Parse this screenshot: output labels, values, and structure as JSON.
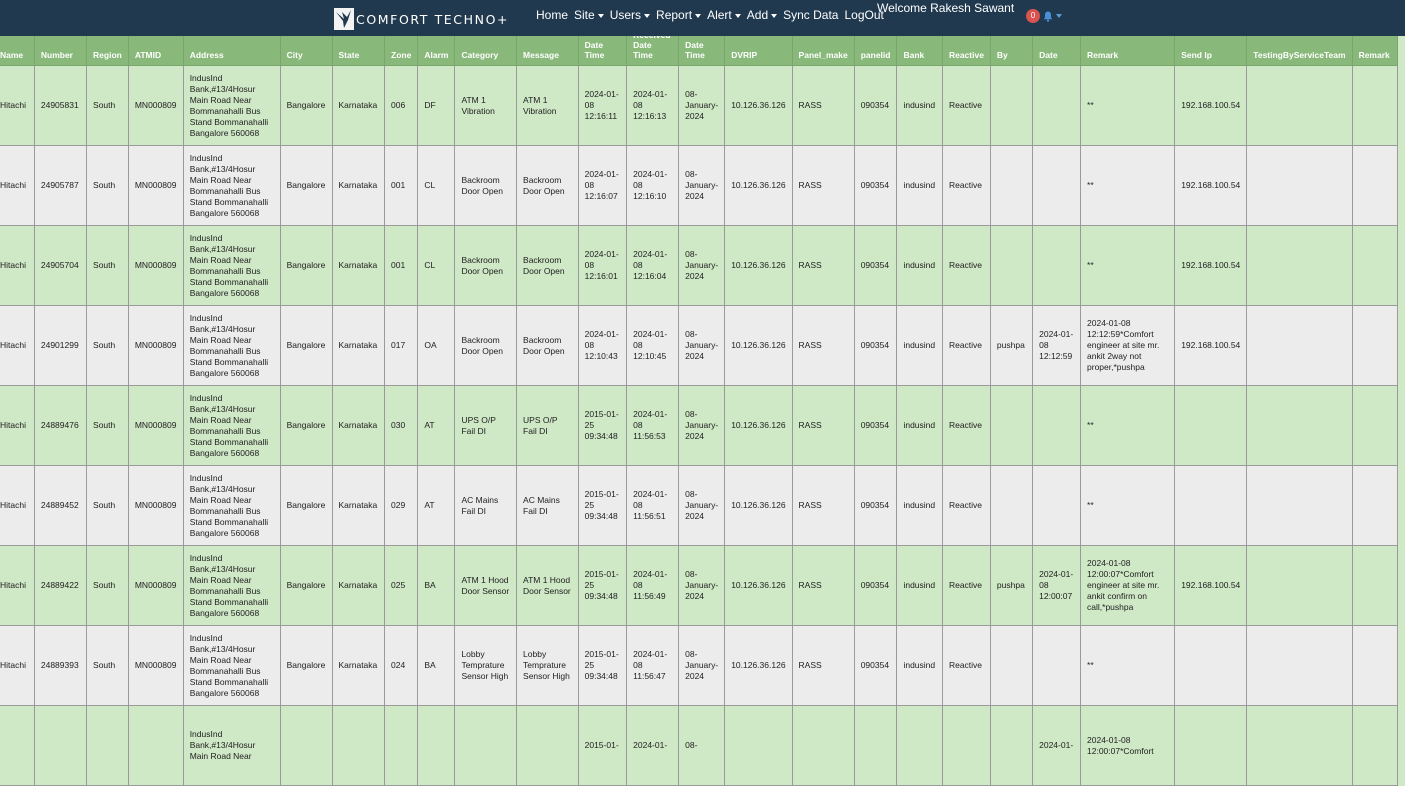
{
  "brand": {
    "name": "COMFORT TECHNO+",
    "logo_icon": "bird-logo-icon"
  },
  "nav": {
    "home": "Home",
    "site": "Site",
    "users": "Users",
    "report": "Report",
    "alert": "Alert",
    "add": "Add",
    "sync": "Sync Data",
    "logout": "LogOut"
  },
  "welcome": "Welcome Rakesh Sawant",
  "notifications": {
    "count": "0",
    "icon": "bell-icon"
  },
  "columns": [
    "Name",
    "Number",
    "Region",
    "ATMID",
    "Address",
    "City",
    "State",
    "Zone",
    "Alarm",
    "Category",
    "Message",
    "Date Time",
    "Received Date Time",
    "Date Time",
    "DVRIP",
    "Panel_make",
    "panelid",
    "Bank",
    "Reactive",
    "By",
    "Date",
    "Remark",
    "Send Ip",
    "TestingByServiceTeam",
    "Remark"
  ],
  "rows": [
    [
      "Hitachi",
      "24905831",
      "South",
      "MN000809",
      "IndusInd Bank,#13/4Hosur Main Road Near Bommanahalli Bus Stand Bommanahalli Bangalore 560068",
      "Bangalore",
      "Karnataka",
      "006",
      "DF",
      "ATM 1 Vibration",
      "ATM 1 Vibration",
      "2024-01-08 12:16:11",
      "2024-01-08 12:16:13",
      "08-January-2024",
      "10.126.36.126",
      "RASS",
      "090354",
      "indusind",
      "Reactive",
      "",
      "",
      "**",
      "192.168.100.54",
      "",
      ""
    ],
    [
      "Hitachi",
      "24905787",
      "South",
      "MN000809",
      "IndusInd Bank,#13/4Hosur Main Road Near Bommanahalli Bus Stand Bommanahalli Bangalore 560068",
      "Bangalore",
      "Karnataka",
      "001",
      "CL",
      "Backroom Door Open",
      "Backroom Door Open",
      "2024-01-08 12:16:07",
      "2024-01-08 12:16:10",
      "08-January-2024",
      "10.126.36.126",
      "RASS",
      "090354",
      "indusind",
      "Reactive",
      "",
      "",
      "**",
      "192.168.100.54",
      "",
      ""
    ],
    [
      "Hitachi",
      "24905704",
      "South",
      "MN000809",
      "IndusInd Bank,#13/4Hosur Main Road Near Bommanahalli Bus Stand Bommanahalli Bangalore 560068",
      "Bangalore",
      "Karnataka",
      "001",
      "CL",
      "Backroom Door Open",
      "Backroom Door Open",
      "2024-01-08 12:16:01",
      "2024-01-08 12:16:04",
      "08-January-2024",
      "10.126.36.126",
      "RASS",
      "090354",
      "indusind",
      "Reactive",
      "",
      "",
      "**",
      "192.168.100.54",
      "",
      ""
    ],
    [
      "Hitachi",
      "24901299",
      "South",
      "MN000809",
      "IndusInd Bank,#13/4Hosur Main Road Near Bommanahalli Bus Stand Bommanahalli Bangalore 560068",
      "Bangalore",
      "Karnataka",
      "017",
      "OA",
      "Backroom Door Open",
      "Backroom Door Open",
      "2024-01-08 12:10:43",
      "2024-01-08 12:10:45",
      "08-January-2024",
      "10.126.36.126",
      "RASS",
      "090354",
      "indusind",
      "Reactive",
      "pushpa",
      "2024-01-08 12:12:59",
      "2024-01-08 12:12:59*Comfort engineer at site mr. ankit 2way not proper,*pushpa",
      "192.168.100.54",
      "",
      ""
    ],
    [
      "Hitachi",
      "24889476",
      "South",
      "MN000809",
      "IndusInd Bank,#13/4Hosur Main Road Near Bommanahalli Bus Stand Bommanahalli Bangalore 560068",
      "Bangalore",
      "Karnataka",
      "030",
      "AT",
      "UPS O/P Fail DI",
      "UPS O/P Fail DI",
      "2015-01-25 09:34:48",
      "2024-01-08 11:56:53",
      "08-January-2024",
      "10.126.36.126",
      "RASS",
      "090354",
      "indusind",
      "Reactive",
      "",
      "",
      "**",
      "",
      "",
      ""
    ],
    [
      "Hitachi",
      "24889452",
      "South",
      "MN000809",
      "IndusInd Bank,#13/4Hosur Main Road Near Bommanahalli Bus Stand Bommanahalli Bangalore 560068",
      "Bangalore",
      "Karnataka",
      "029",
      "AT",
      "AC Mains Fail DI",
      "AC Mains Fail DI",
      "2015-01-25 09:34:48",
      "2024-01-08 11:56:51",
      "08-January-2024",
      "10.126.36.126",
      "RASS",
      "090354",
      "indusind",
      "Reactive",
      "",
      "",
      "**",
      "",
      "",
      ""
    ],
    [
      "Hitachi",
      "24889422",
      "South",
      "MN000809",
      "IndusInd Bank,#13/4Hosur Main Road Near Bommanahalli Bus Stand Bommanahalli Bangalore 560068",
      "Bangalore",
      "Karnataka",
      "025",
      "BA",
      "ATM 1 Hood Door Sensor",
      "ATM 1 Hood Door Sensor",
      "2015-01-25 09:34:48",
      "2024-01-08 11:56:49",
      "08-January-2024",
      "10.126.36.126",
      "RASS",
      "090354",
      "indusind",
      "Reactive",
      "pushpa",
      "2024-01-08 12:00:07",
      "2024-01-08 12:00:07*Comfort engineer at site mr. ankit confirm on call,*pushpa",
      "192.168.100.54",
      "",
      ""
    ],
    [
      "Hitachi",
      "24889393",
      "South",
      "MN000809",
      "IndusInd Bank,#13/4Hosur Main Road Near Bommanahalli Bus Stand Bommanahalli Bangalore 560068",
      "Bangalore",
      "Karnataka",
      "024",
      "BA",
      "Lobby Temprature Sensor High",
      "Lobby Temprature Sensor High",
      "2015-01-25 09:34:48",
      "2024-01-08 11:56:47",
      "08-January-2024",
      "10.126.36.126",
      "RASS",
      "090354",
      "indusind",
      "Reactive",
      "",
      "",
      "**",
      "",
      "",
      ""
    ],
    [
      "",
      "",
      "",
      "",
      "IndusInd Bank,#13/4Hosur Main Road Near",
      "",
      "",
      "",
      "",
      "",
      "",
      "2015-01-",
      "2024-01-",
      "08-",
      "",
      "",
      "",
      "",
      "",
      "",
      "2024-01-",
      "2024-01-08 12:00:07*Comfort",
      "",
      "",
      ""
    ]
  ]
}
